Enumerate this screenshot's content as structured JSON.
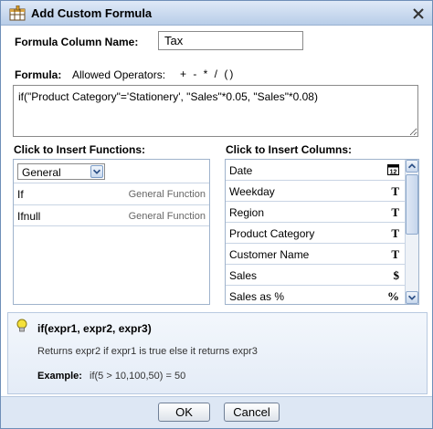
{
  "window": {
    "title": "Add Custom Formula"
  },
  "formula_name": {
    "label": "Formula Column Name:",
    "value": "Tax"
  },
  "formula": {
    "label": "Formula:",
    "operators_label": "Allowed Operators:",
    "operators": "+ - * / ()",
    "expression": "if(\"Product Category\"='Stationery', \"Sales\"*0.05, \"Sales\"*0.08)"
  },
  "functions": {
    "label": "Click to Insert Functions:",
    "category_selected": "General",
    "items": [
      {
        "name": "If",
        "category": "General Function"
      },
      {
        "name": "Ifnull",
        "category": "General Function"
      }
    ]
  },
  "columns": {
    "label": "Click to Insert Columns:",
    "items": [
      {
        "name": "Date",
        "type": "date-icon"
      },
      {
        "name": "Weekday",
        "type": "T"
      },
      {
        "name": "Region",
        "type": "T"
      },
      {
        "name": "Product Category",
        "type": "T"
      },
      {
        "name": "Customer Name",
        "type": "T"
      },
      {
        "name": "Sales",
        "type": "$"
      },
      {
        "name": "Sales as %",
        "type": "%"
      }
    ]
  },
  "help": {
    "signature": "if(expr1, expr2, expr3)",
    "description": "Returns expr2 if expr1 is true else it returns expr3",
    "example_label": "Example:",
    "example": "if(5 > 10,100,50) = 50"
  },
  "buttons": {
    "ok": "OK",
    "cancel": "Cancel"
  },
  "colors": {
    "titlebar": "#b8cde8",
    "footer": "#dde7f4",
    "border": "#6f8fb8"
  }
}
